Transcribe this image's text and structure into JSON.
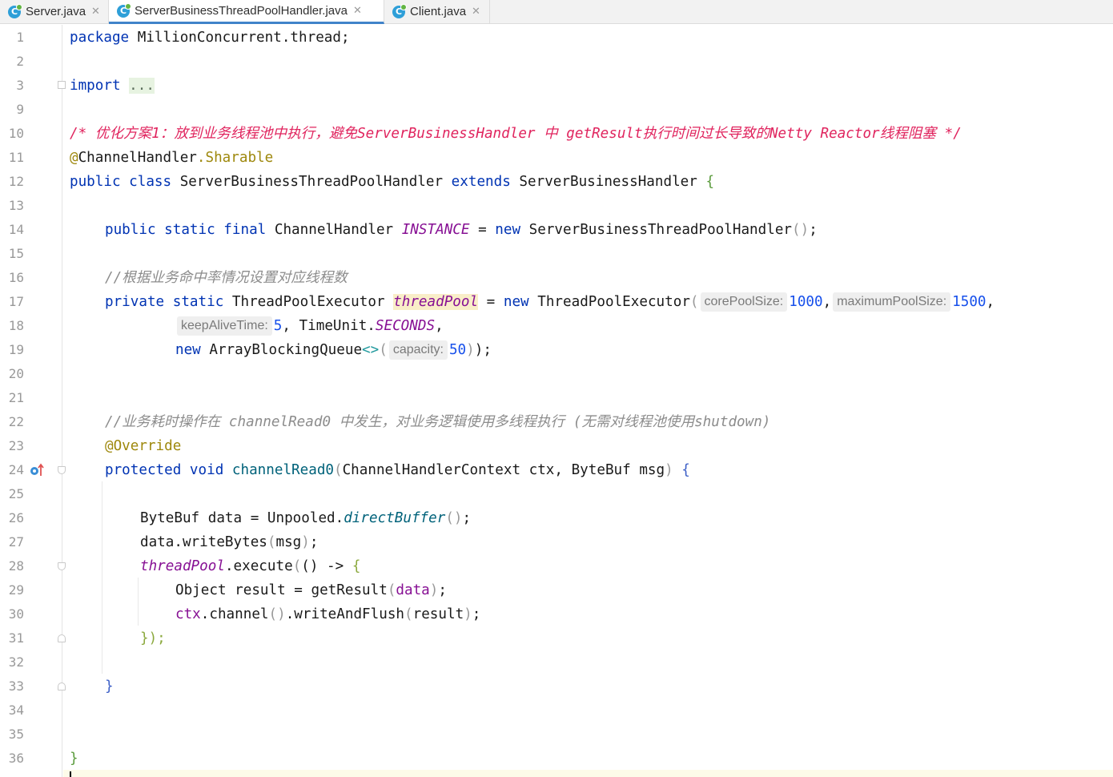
{
  "tabs": [
    {
      "label": "Server.java",
      "active": false
    },
    {
      "label": "ServerBusinessThreadPoolHandler.java",
      "active": true
    },
    {
      "label": "Client.java",
      "active": false
    }
  ],
  "editor": {
    "line_numbers": [
      "1",
      "2",
      "3",
      "9",
      "10",
      "11",
      "12",
      "13",
      "14",
      "15",
      "16",
      "17",
      "18",
      "19",
      "20",
      "21",
      "22",
      "23",
      "24",
      "25",
      "26",
      "27",
      "28",
      "29",
      "30",
      "31",
      "32",
      "33",
      "34",
      "35",
      "36"
    ],
    "code": {
      "l1_kw": "package",
      "l1_rest": " MillionConcurrent.thread;",
      "l3_kw": "import",
      "l3_folded": "...",
      "l10_comment": "/* 优化方案1：放到业务线程池中执行，避免ServerBusinessHandler 中 getResult执行时间过长导致的Netty Reactor线程阻塞 */",
      "l11_at": "@",
      "l11_cls": "ChannelHandler",
      "l11_ann": ".Sharable",
      "l12_kw1": "public class",
      "l12_cls": " ServerBusinessThreadPoolHandler ",
      "l12_kw2": "extends",
      "l12_sup": " ServerBusinessHandler ",
      "l12_brace": "{",
      "l14_kw": "public static final",
      "l14_type": " ChannelHandler ",
      "l14_const": "INSTANCE",
      "l14_eq": " = ",
      "l14_new": "new",
      "l14_ctor": " ServerBusinessThreadPoolHandler",
      "l14_paren": "()",
      "l14_semi": ";",
      "l16_comment": "//根据业务命中率情况设置对应线程数",
      "l17_kw": "private static",
      "l17_type": " ThreadPoolExecutor ",
      "l17_field": "threadPool",
      "l17_eq": " = ",
      "l17_new": "new",
      "l17_ctor": " ThreadPoolExecutor",
      "l17_paren": "(",
      "hint_core": "corePoolSize:",
      "val_core": "1000",
      "hint_max": "maximumPoolSize:",
      "val_max": "1500",
      "hint_keep": "keepAliveTime:",
      "val_keep": "5",
      "l18_unit": " TimeUnit.",
      "l18_const": "SECONDS",
      "l19_new": "new",
      "l19_cls": " ArrayBlockingQueue",
      "l19_diamond": "<>",
      "hint_cap": "capacity:",
      "val_cap": "50",
      "l22_comment": "//业务耗时操作在 channelRead0 中发生，对业务逻辑使用多线程执行 (无需对线程池使用shutdown)",
      "l23_ann": "@Override",
      "l24_kw": "protected void",
      "l24_meth": " channelRead0",
      "l24_params": "ChannelHandlerContext ctx, ByteBuf msg",
      "l26_a": "ByteBuf data = Unpooled.",
      "l26_meth": "directBuffer",
      "l27_a": "data.writeBytes",
      "l27_b": "msg",
      "l28_field": "threadPool",
      "l28_a": ".execute",
      "l28_b": "() -> ",
      "l29_a": "Object result = getResult",
      "l29_b": "data",
      "l30_a": "ctx",
      "l30_b": ".channel",
      "l30_c": ".writeAndFlush",
      "l30_d": "result",
      "l31": "});",
      "l33": "}",
      "l36": "}"
    }
  },
  "colors": {
    "keyword": "#0033b3",
    "annotation": "#9e880d",
    "comment": "#8c8c8c",
    "doc_comment": "#e0245e",
    "number": "#1750eb",
    "static_field": "#871094",
    "method": "#00627a",
    "active_tab_underline": "#4083c9"
  },
  "icons": [
    "java-class-icon",
    "close-icon",
    "fold-icon",
    "override-method-icon"
  ]
}
